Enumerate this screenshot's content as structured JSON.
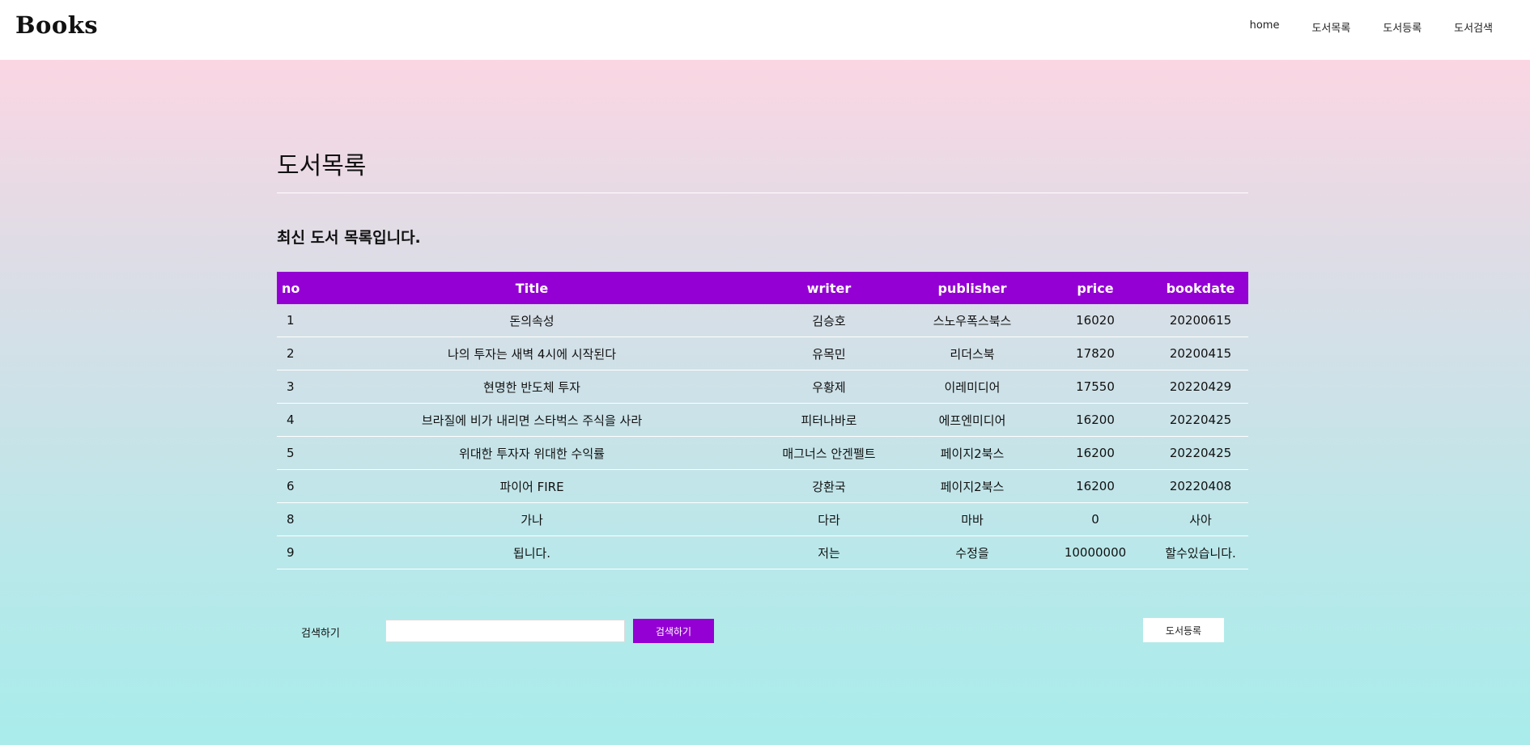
{
  "brand": "Books",
  "nav": [
    "home",
    "도서목록",
    "도서등록",
    "도서검색"
  ],
  "page_title": "도서목록",
  "subtitle": "최신 도서 목록입니다.",
  "table": {
    "headers": [
      "no",
      "Title",
      "writer",
      "publisher",
      "price",
      "bookdate"
    ],
    "rows": [
      [
        "1",
        "돈의속성",
        "김승호",
        "스노우폭스북스",
        "16020",
        "20200615"
      ],
      [
        "2",
        "나의 투자는 새벽 4시에 시작된다",
        "유목민",
        "리더스북",
        "17820",
        "20200415"
      ],
      [
        "3",
        "현명한 반도체 투자",
        "우황제",
        "이레미디어",
        "17550",
        "20220429"
      ],
      [
        "4",
        "브라질에 비가 내리면 스타벅스 주식을 사라",
        "피터나바로",
        "에프엔미디어",
        "16200",
        "20220425"
      ],
      [
        "5",
        "위대한 투자자 위대한 수익률",
        "매그너스 안겐펠트",
        "페이지2북스",
        "16200",
        "20220425"
      ],
      [
        "6",
        "파이어 FIRE",
        "강환국",
        "페이지2북스",
        "16200",
        "20220408"
      ],
      [
        "8",
        "가나",
        "다라",
        "마바",
        "0",
        "사아"
      ],
      [
        "9",
        "됩니다.",
        "저는",
        "수정을",
        "10000000",
        "할수있습니다."
      ]
    ]
  },
  "search": {
    "label": "검색하기",
    "value": "",
    "button_label": "검색하기"
  },
  "register_button_label": "도서등록",
  "colors": {
    "accent": "#9400d3",
    "gradient_top": "#fbd6e3",
    "gradient_bottom": "#a9eceb"
  }
}
